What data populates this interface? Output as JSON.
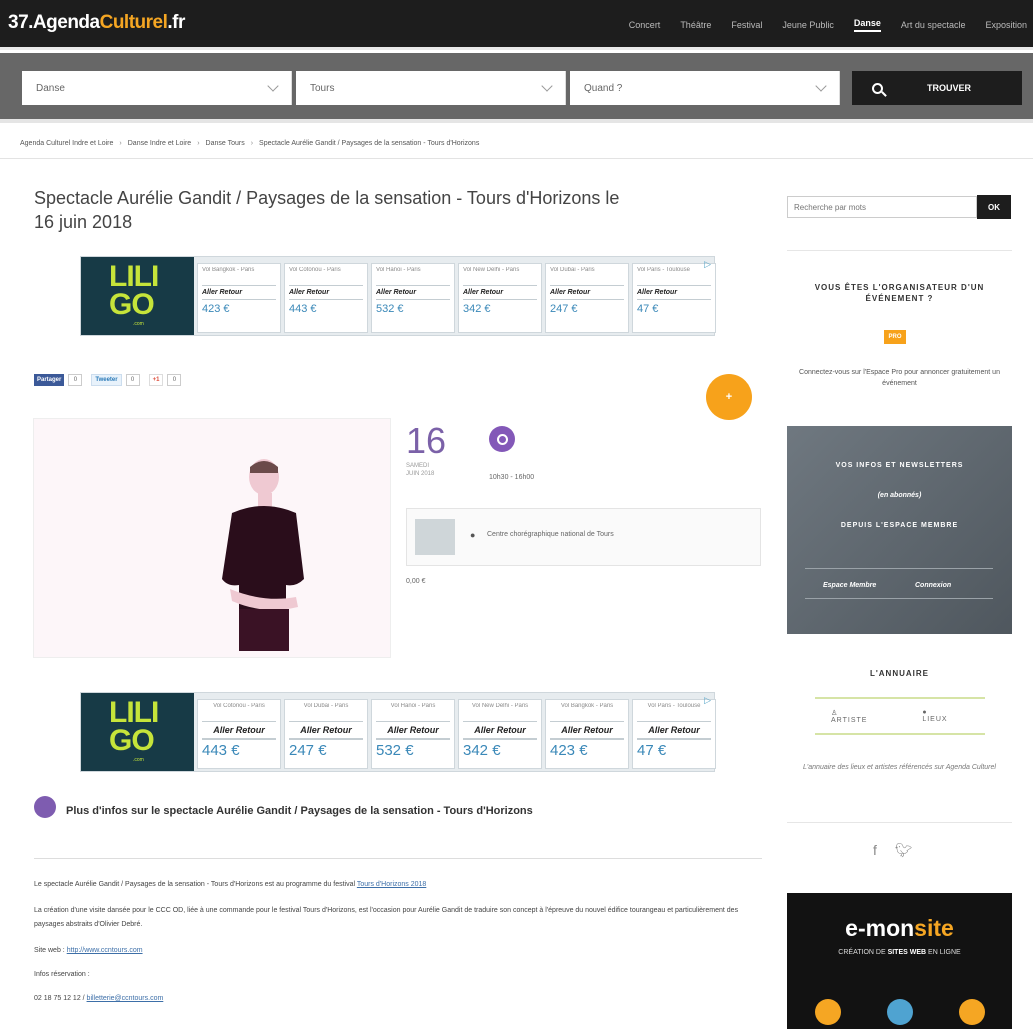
{
  "nav": {
    "logo": {
      "prefix": "37.",
      "brand": "Agenda",
      "brand2": "Culturel",
      "suffix": ".fr"
    },
    "links": [
      "Concert",
      "Théâtre",
      "Festival",
      "Jeune Public",
      "Danse",
      "Art du spectacle",
      "Exposition"
    ],
    "active": "Danse"
  },
  "search": {
    "category": "Danse",
    "city": "Tours",
    "when": "Quand ?",
    "button": "TROUVER"
  },
  "breadcrumb": [
    "Agenda Culturel Indre et Loire",
    "Danse Indre et Loire",
    "Danse Tours",
    "Spectacle Aurélie Gandit / Paysages de la sensation - Tours d'Horizons"
  ],
  "title": "Spectacle Aurélie Gandit / Paysages de la sensation - Tours d'Horizons le 16 juin 2018",
  "ad1": {
    "brand": [
      "LILI",
      "GO",
      ".com"
    ],
    "offers": [
      {
        "route": "Vol Bangkok - Paris",
        "label": "Aller Retour",
        "price": "423 €"
      },
      {
        "route": "Vol Cotonou - Paris",
        "label": "Aller Retour",
        "price": "443 €"
      },
      {
        "route": "Vol Hanoi - Paris",
        "label": "Aller Retour",
        "price": "532 €"
      },
      {
        "route": "Vol New Delhi - Paris",
        "label": "Aller Retour",
        "price": "342 €"
      },
      {
        "route": "Vol Dubai - Paris",
        "label": "Aller Retour",
        "price": "247 €"
      },
      {
        "route": "Vol Paris - Toulouse",
        "label": "Aller Retour",
        "price": "47 €"
      }
    ]
  },
  "share": {
    "facebook": "Partager",
    "facebook_count": "0",
    "twitter": "Tweeter",
    "twitter_count": "0",
    "gplus": "+1",
    "gplus_count": "0"
  },
  "event": {
    "day": "16",
    "day_label1": "SAMEDI",
    "day_label2": "JUIN 2018",
    "time": "10h30 - 16h00",
    "venue": "Centre chorégraphique national de Tours",
    "price": "0,00 €"
  },
  "ad2": {
    "brand": [
      "LILI",
      "GO",
      ".com"
    ],
    "offers": [
      {
        "route": "Vol Cotonou - Paris",
        "label": "Aller Retour",
        "price": "443 €"
      },
      {
        "route": "Vol Dubai - Paris",
        "label": "Aller Retour",
        "price": "247 €"
      },
      {
        "route": "Vol Hanoi - Paris",
        "label": "Aller Retour",
        "price": "532 €"
      },
      {
        "route": "Vol New Delhi - Paris",
        "label": "Aller Retour",
        "price": "342 €"
      },
      {
        "route": "Vol Bangkok - Paris",
        "label": "Aller Retour",
        "price": "423 €"
      },
      {
        "route": "Vol Paris - Toulouse",
        "label": "Aller Retour",
        "price": "47 €"
      }
    ]
  },
  "more": {
    "heading": "Plus d'infos sur le spectacle Aurélie Gandit / Paysages de la sensation - Tours d'Horizons",
    "p1_text": "Le spectacle Aurélie Gandit / Paysages de la sensation - Tours d'Horizons est au programme du festival ",
    "p1_link": "Tours d'Horizons 2018",
    "p2": "La création d'une visite dansée pour le CCC OD, liée à une commande pour le festival Tours d'Horizons, est l'occasion pour Aurélie Gandit de traduire son concept à l'épreuve du nouvel édifice tourangeau et particulièrement des paysages abstraits d'Olivier Debré.",
    "site_label": "Site web : ",
    "site_link": "http://www.ccntours.com",
    "resa": "Infos réservation :",
    "phone": "02 18 75 12 12 / ",
    "email": "billetterie@ccntours.com"
  },
  "sidebar": {
    "search_placeholder": "Recherche par mots",
    "ok": "OK",
    "org_title": "VOUS ÊTES L'ORGANISATEUR D'UN ÉVÉNEMENT ?",
    "pro": "PRO",
    "org_text": "Connectez-vous sur l'Espace Pro pour annoncer gratuitement un événement",
    "news1": "VOS INFOS ET NEWSLETTERS",
    "news2": "(en abonnés)",
    "news3": "DEPUIS L'ESPACE MEMBRE",
    "news_link1": "Espace Membre",
    "news_link2": "Connexion",
    "annuaire": "L'ANNUAIRE",
    "artistes": "ARTISTE",
    "lieux": "LIEUX",
    "annu_text": "L'annuaire des lieux et artistes référencés sur Agenda Culturel",
    "emonsite_a": "e-mon",
    "emonsite_b": "site",
    "emonsite_tag1": "CRÉATION DE ",
    "emonsite_tag2": "SITES WEB",
    "emonsite_tag3": " EN LIGNE"
  },
  "colors": {
    "accent": "#f7a21b",
    "purple": "#7b61a8",
    "dark": "#1d1d1d",
    "ad_bg": "#173a46",
    "ad_green": "#c6e43a"
  }
}
